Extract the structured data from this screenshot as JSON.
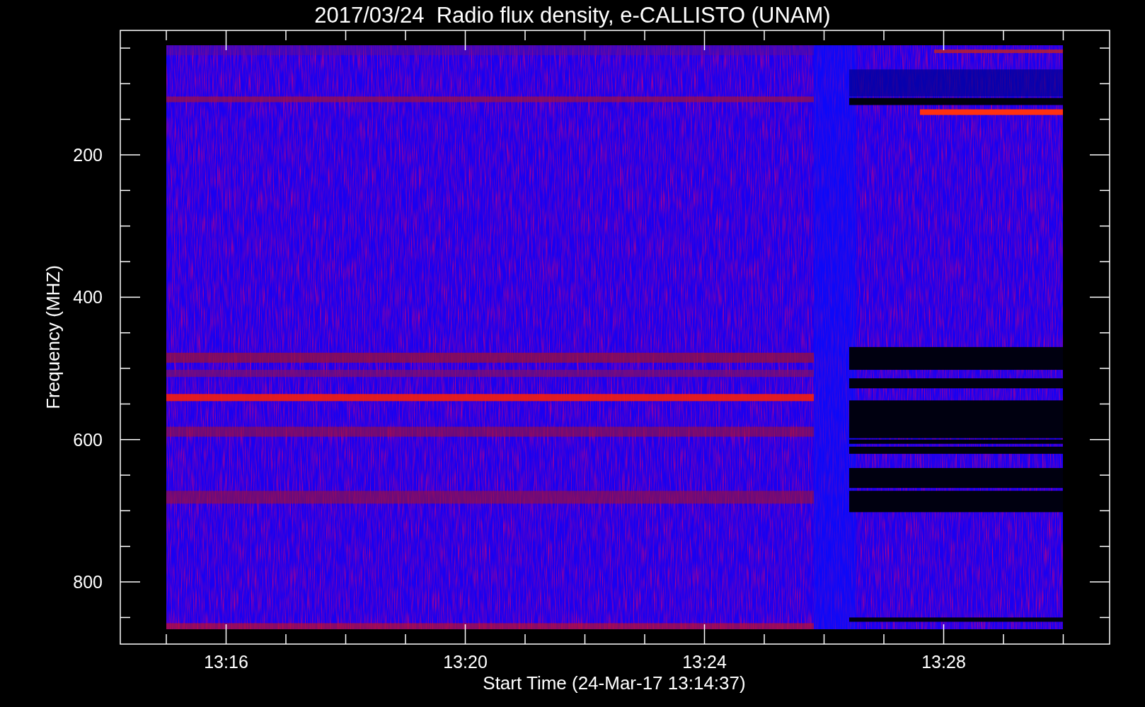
{
  "title": "2017/03/24  Radio flux density, e-CALLISTO (UNAM)",
  "y_axis": {
    "label": "Frequency (MHZ)",
    "ticks": [
      "200",
      "400",
      "600",
      "800"
    ]
  },
  "x_axis": {
    "label": "Start Time (24-Mar-17 13:14:37)",
    "ticks": [
      "13:16",
      "13:20",
      "13:24",
      "13:28"
    ]
  }
}
